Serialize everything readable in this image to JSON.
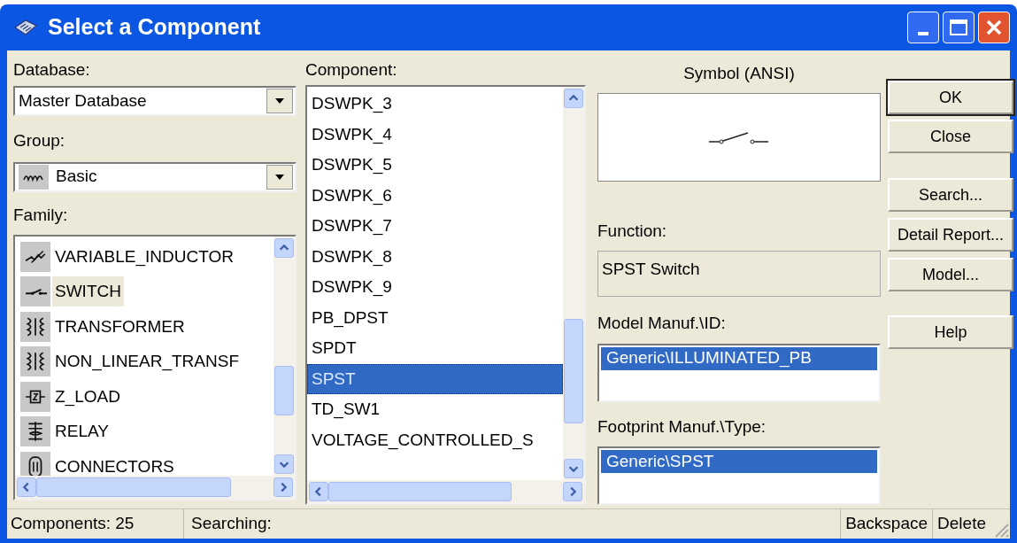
{
  "window": {
    "title": "Select a Component"
  },
  "database": {
    "label": "Database:",
    "value": "Master Database"
  },
  "group": {
    "label": "Group:",
    "value": "Basic"
  },
  "family": {
    "label": "Family:",
    "items": [
      {
        "label": "VARIABLE_INDUCTOR",
        "selected": false
      },
      {
        "label": "SWITCH",
        "selected": true
      },
      {
        "label": "TRANSFORMER",
        "selected": false
      },
      {
        "label": "NON_LINEAR_TRANSF",
        "selected": false
      },
      {
        "label": "Z_LOAD",
        "selected": false
      },
      {
        "label": "RELAY",
        "selected": false
      },
      {
        "label": "CONNECTORS",
        "selected": false
      }
    ]
  },
  "component": {
    "label": "Component:",
    "items": [
      {
        "label": "DSWPK_3",
        "selected": false
      },
      {
        "label": "DSWPK_4",
        "selected": false
      },
      {
        "label": "DSWPK_5",
        "selected": false
      },
      {
        "label": "DSWPK_6",
        "selected": false
      },
      {
        "label": "DSWPK_7",
        "selected": false
      },
      {
        "label": "DSWPK_8",
        "selected": false
      },
      {
        "label": "DSWPK_9",
        "selected": false
      },
      {
        "label": "PB_DPST",
        "selected": false
      },
      {
        "label": "SPDT",
        "selected": false
      },
      {
        "label": "SPST",
        "selected": true
      },
      {
        "label": "TD_SW1",
        "selected": false
      },
      {
        "label": "VOLTAGE_CONTROLLED_S",
        "selected": false
      }
    ]
  },
  "symbol": {
    "label": "Symbol (ANSI)"
  },
  "function": {
    "label": "Function:",
    "value": "SPST Switch"
  },
  "model": {
    "label": "Model Manuf.\\ID:",
    "items": [
      {
        "label": "Generic\\ILLUMINATED_PB",
        "selected": true
      }
    ]
  },
  "footprint": {
    "label": "Footprint Manuf.\\Type:",
    "items": [
      {
        "label": "Generic\\SPST",
        "selected": true
      }
    ]
  },
  "buttons": [
    {
      "label": "OK",
      "default": true
    },
    {
      "label": "Close",
      "default": false
    },
    {
      "label": "Search...",
      "default": false
    },
    {
      "label": "Detail Report...",
      "default": false
    },
    {
      "label": "Model...",
      "default": false
    },
    {
      "label": "Help",
      "default": false
    }
  ],
  "status_bar": {
    "count": "Components: 25",
    "searching": "Searching:",
    "keys": [
      "Backspace",
      "Delete"
    ]
  }
}
